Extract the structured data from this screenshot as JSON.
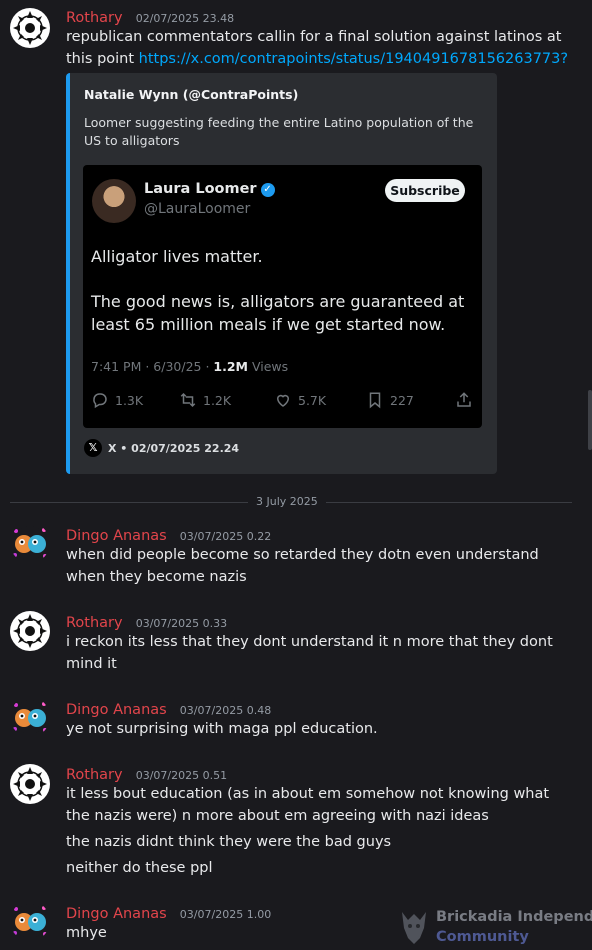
{
  "messages": [
    {
      "author": "Rothary",
      "timestamp": "02/07/2025 23.48",
      "text": "republican commentators callin for a final solution against latinos at this point ",
      "link": "https://x.com/contrapoints/status/1940491678156263773?s=46",
      "embed": {
        "author": "Natalie Wynn (@ContraPoints)",
        "description": "Loomer suggesting feeding the entire Latino population of the US to alligators",
        "tweet": {
          "name": "Laura Loomer",
          "handle": "@LauraLoomer",
          "subscribe_label": "Subscribe",
          "body_line1": "Alligator lives matter.",
          "body_line2": "The good news is, alligators are guaranteed at least 65 million meals if we get started now.",
          "meta_prefix": "7:41 PM · 6/30/25 · ",
          "views_count": "1.2M",
          "views_label": " Views",
          "replies": "1.3K",
          "reposts": "1.2K",
          "likes": "5.7K",
          "bookmarks": "227"
        },
        "footer": "X • 02/07/2025 22.24"
      }
    }
  ],
  "date_divider": "3 July 2025",
  "messages2": [
    {
      "author": "Dingo Ananas",
      "timestamp": "03/07/2025 0.22",
      "lines": [
        "when did people become so retarded they dotn even understand when they become nazis"
      ]
    },
    {
      "author": "Rothary",
      "timestamp": "03/07/2025 0.33",
      "lines": [
        "i reckon its less that they dont understand it n more that they dont mind it"
      ]
    },
    {
      "author": "Dingo Ananas",
      "timestamp": "03/07/2025 0.48",
      "lines": [
        "ye not surprising with maga ppl education."
      ]
    },
    {
      "author": "Rothary",
      "timestamp": "03/07/2025 0.51",
      "lines": [
        "it less bout education (as in about em somehow not knowing what the nazis were) n more about em agreeing with nazi ideas",
        "the nazis didnt think they were the bad guys",
        "neither do these ppl"
      ]
    },
    {
      "author": "Dingo Ananas",
      "timestamp": "03/07/2025 1.00",
      "lines": [
        "mhye"
      ]
    }
  ],
  "watermark": {
    "line1": "Brickadia Independent",
    "line2": "Community"
  },
  "colors": {
    "author": "#e2454b",
    "link": "#00a8fc",
    "embed_border": "#1d9bf0",
    "background": "#1a1a1e"
  }
}
